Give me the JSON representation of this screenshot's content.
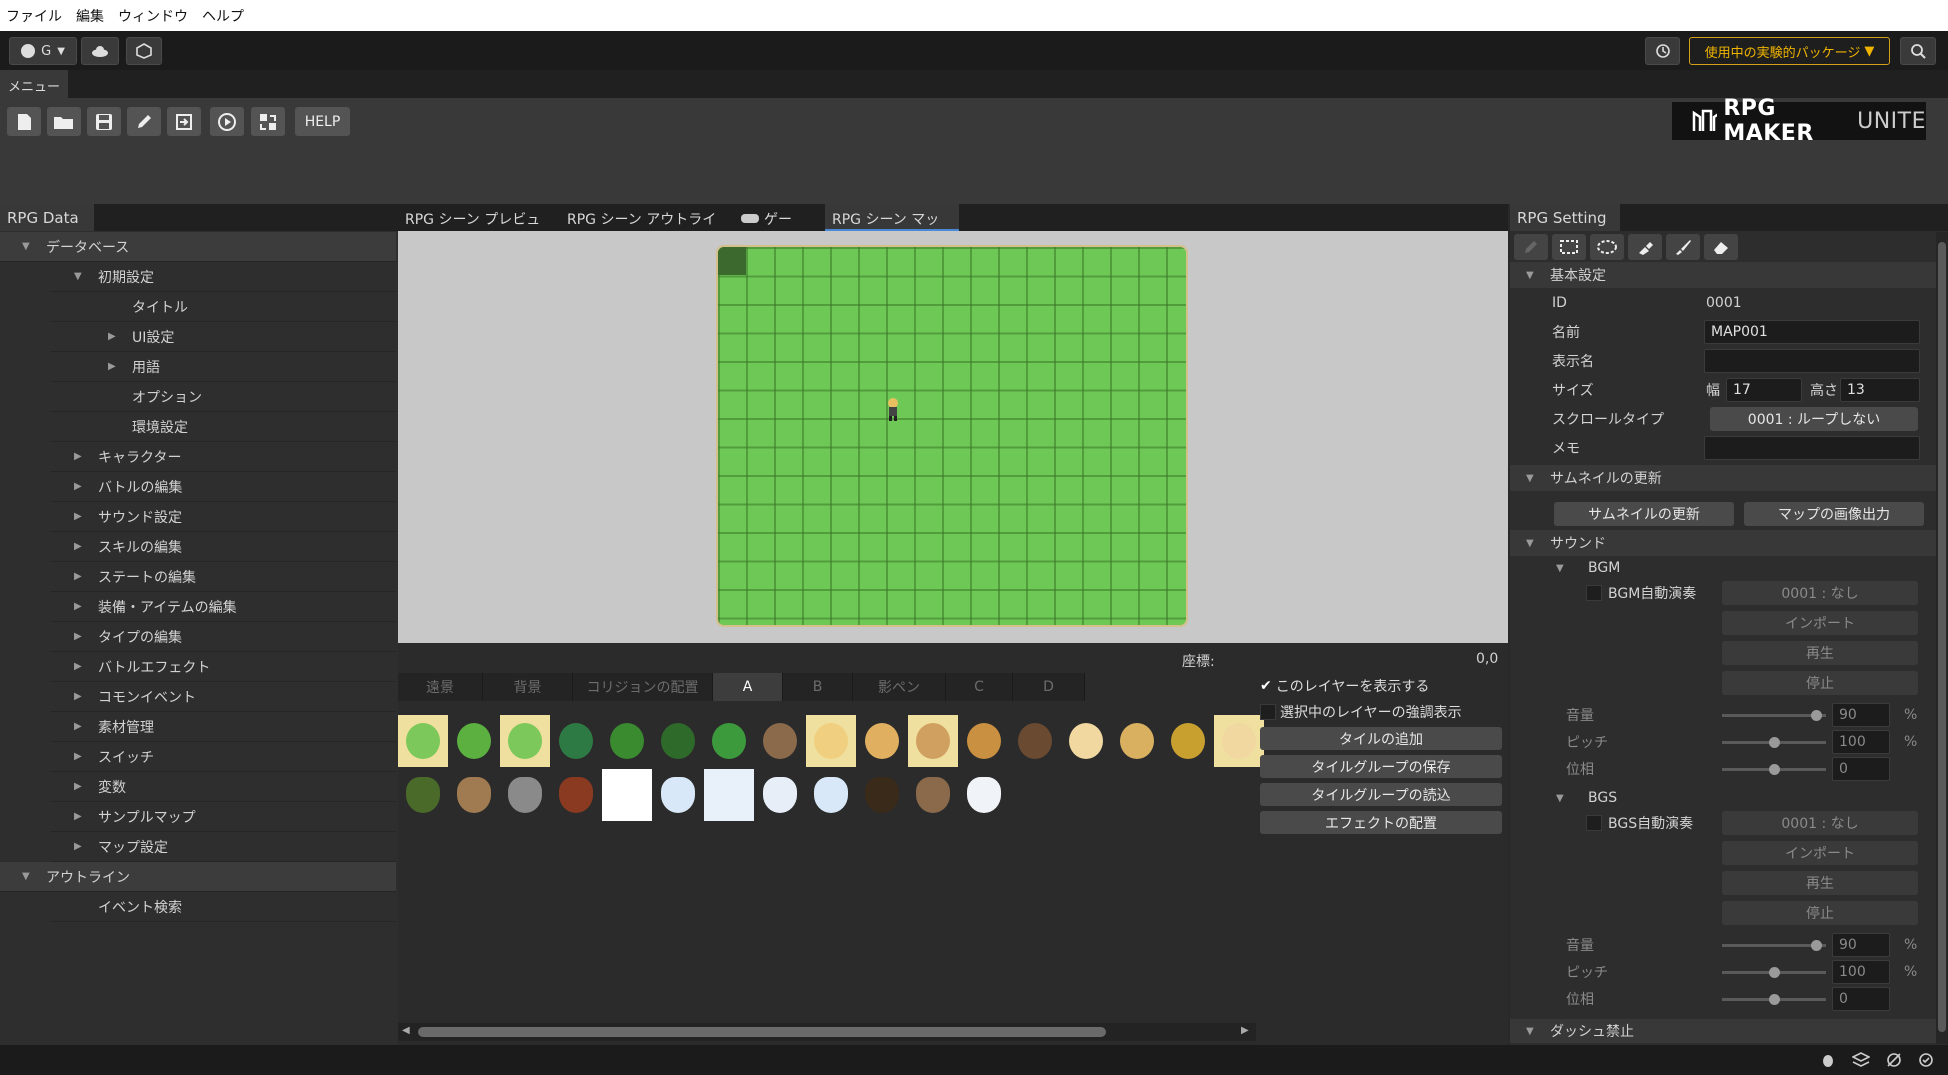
{
  "menubar": [
    "ファイル",
    "編集",
    "ウィンドウ",
    "ヘルプ"
  ],
  "topbar": {
    "account_label": "G",
    "packages_label": "使用中の実験的パッケージ"
  },
  "menu": {
    "tab": "メニュー",
    "help_label": "HELP",
    "logo_main": "RPG MAKER",
    "logo_sub": "UNITE"
  },
  "left_panel": {
    "tab": "RPG Data",
    "items": [
      {
        "label": "データベース",
        "level": 0,
        "arrow": "down",
        "header": true
      },
      {
        "label": "初期設定",
        "level": 1,
        "arrow": "down"
      },
      {
        "label": "タイトル",
        "level": 2,
        "arrow": ""
      },
      {
        "label": "UI設定",
        "level": 2,
        "arrow": "right"
      },
      {
        "label": "用語",
        "level": 2,
        "arrow": "right"
      },
      {
        "label": "オプション",
        "level": 2,
        "arrow": ""
      },
      {
        "label": "環境設定",
        "level": 2,
        "arrow": ""
      },
      {
        "label": "キャラクター",
        "level": 1,
        "arrow": "right"
      },
      {
        "label": "バトルの編集",
        "level": 1,
        "arrow": "right"
      },
      {
        "label": "サウンド設定",
        "level": 1,
        "arrow": "right"
      },
      {
        "label": "スキルの編集",
        "level": 1,
        "arrow": "right"
      },
      {
        "label": "ステートの編集",
        "level": 1,
        "arrow": "right"
      },
      {
        "label": "装備・アイテムの編集",
        "level": 1,
        "arrow": "right"
      },
      {
        "label": "タイプの編集",
        "level": 1,
        "arrow": "right"
      },
      {
        "label": "バトルエフェクト",
        "level": 1,
        "arrow": "right"
      },
      {
        "label": "コモンイベント",
        "level": 1,
        "arrow": "right"
      },
      {
        "label": "素材管理",
        "level": 1,
        "arrow": "right"
      },
      {
        "label": "スイッチ",
        "level": 1,
        "arrow": "right"
      },
      {
        "label": "変数",
        "level": 1,
        "arrow": "right"
      },
      {
        "label": "サンプルマップ",
        "level": 1,
        "arrow": "right"
      },
      {
        "label": "マップ設定",
        "level": 1,
        "arrow": "right"
      },
      {
        "label": "アウトライン",
        "level": 0,
        "arrow": "down",
        "header": true
      },
      {
        "label": "イベント検索",
        "level": 1,
        "arrow": ""
      }
    ]
  },
  "center": {
    "tabs": [
      "RPG シーン プレビュー",
      "RPG シーン アウトライン",
      "ゲーム",
      "RPG シーン マップ"
    ],
    "active_tab": 3,
    "coord_label": "座標:",
    "coord_value": "0,0",
    "tile_tabs": [
      "遠景",
      "背景",
      "コリジョンの配置",
      "A",
      "B",
      "影ペン",
      "C",
      "D"
    ],
    "active_tile_tab": 3,
    "layer_options": [
      "このレイヤーを表示する",
      "選択中のレイヤーの強調表示"
    ],
    "actions": [
      "タイルの追加",
      "タイルグループの保存",
      "タイルグループの読込",
      "エフェクトの配置"
    ]
  },
  "right_panel": {
    "tab": "RPG Setting",
    "basic_section": "基本設定",
    "id_label": "ID",
    "id_value": "0001",
    "name_label": "名前",
    "name_value": "MAP001",
    "display_name_label": "表示名",
    "display_name_value": "",
    "size_label": "サイズ",
    "width_label": "幅",
    "width_value": "17",
    "height_label": "高さ",
    "height_value": "13",
    "scroll_label": "スクロールタイプ",
    "scroll_value": "0001 : ループしない",
    "memo_label": "メモ",
    "memo_value": "",
    "thumb_section": "サムネイルの更新",
    "thumb_btn": "サムネイルの更新",
    "export_btn": "マップの画像出力",
    "sound_section": "サウンド",
    "bgm": {
      "title": "BGM",
      "auto": "BGM自動演奏",
      "value": "0001 : なし",
      "import": "インポート",
      "play": "再生",
      "stop": "停止",
      "volume_label": "音量",
      "volume": "90",
      "pitch_label": "ピッチ",
      "pitch": "100",
      "phase_label": "位相",
      "phase": "0"
    },
    "bgs": {
      "title": "BGS",
      "auto": "BGS自動演奏",
      "value": "0001 : なし",
      "import": "インポート",
      "play": "再生",
      "stop": "停止",
      "volume_label": "音量",
      "volume": "90",
      "pitch_label": "ピッチ",
      "pitch": "100",
      "phase_label": "位相",
      "phase": "0"
    },
    "percent": "%",
    "dash_section": "ダッシュ禁止"
  }
}
